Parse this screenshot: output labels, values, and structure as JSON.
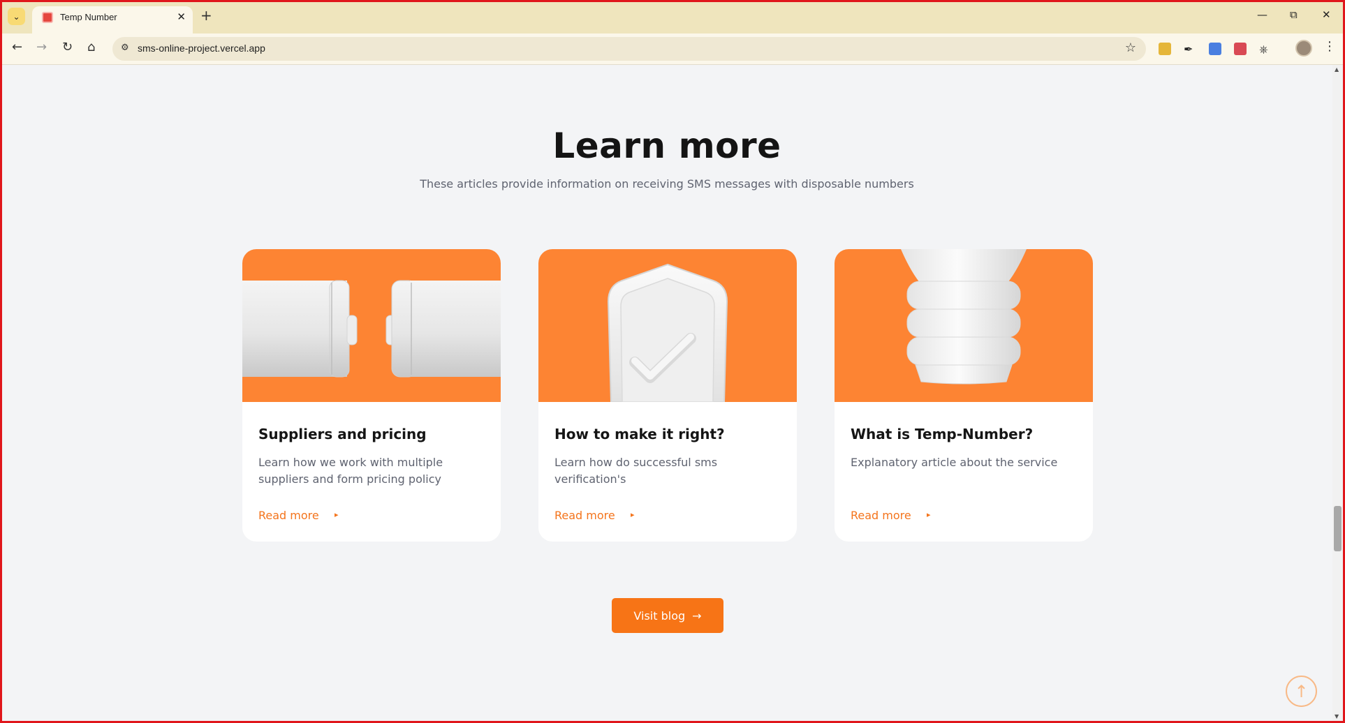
{
  "browser": {
    "tab_title": "Temp Number",
    "url": "sms-online-project.vercel.app"
  },
  "icons": {
    "tab_menu": "chevron-down-icon",
    "close_tab": "close-icon",
    "new_tab": "plus-icon",
    "back": "arrow-left-icon",
    "forward": "arrow-right-icon",
    "reload": "reload-icon",
    "home": "home-icon",
    "star": "star-icon",
    "scroll_top": "arrow-up-circle-icon"
  },
  "section": {
    "title": "Learn more",
    "subtitle": "These articles provide information on receiving SMS messages with disposable numbers"
  },
  "cards": [
    {
      "title": "Suppliers and pricing",
      "description": "Learn how we work with multiple suppliers and form pricing policy",
      "link": "Read more",
      "image": "battery-illustration"
    },
    {
      "title": "How to make it right?",
      "description": "Learn how do successful sms verification's",
      "link": "Read more",
      "image": "shield-check-illustration"
    },
    {
      "title": "What is Temp-Number?",
      "description": "Explanatory article about the service",
      "link": "Read more",
      "image": "lightbulb-illustration"
    }
  ],
  "visit_button": {
    "label": "Visit blog"
  },
  "colors": {
    "accent": "#f77416",
    "card_image_bg": "#fd8433",
    "page_bg": "#f3f4f6"
  }
}
